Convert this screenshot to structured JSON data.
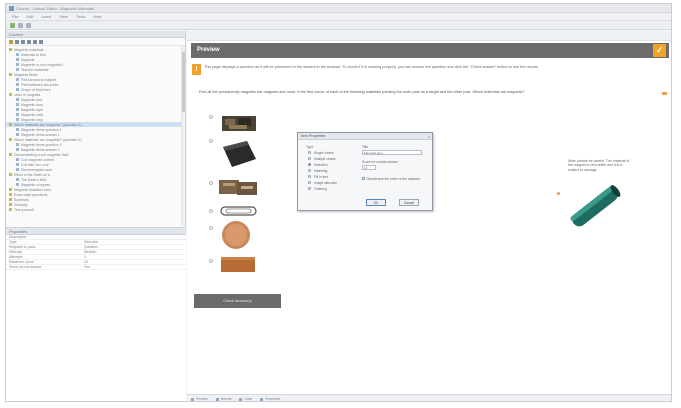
{
  "window": {
    "title": "Course - Lesson Editor - Magnetic Materials"
  },
  "menubar": [
    "File",
    "Edit",
    "Insert",
    "View",
    "Tools",
    "Help"
  ],
  "left_pane": {
    "header": "Content",
    "tree": [
      {
        "label": "Magnetic materials",
        "level": 0,
        "type": "folder"
      },
      {
        "label": "Materials to test",
        "level": 1,
        "type": "page"
      },
      {
        "label": "Magnets",
        "level": 1,
        "type": "page"
      },
      {
        "label": "Magnetic or non-magnetic?",
        "level": 1,
        "type": "page"
      },
      {
        "label": "Test the materials",
        "level": 1,
        "type": "page"
      },
      {
        "label": "Magnetic fields",
        "level": 0,
        "type": "folder"
      },
      {
        "label": "Field around a magnet",
        "level": 1,
        "type": "page"
      },
      {
        "label": "Field between two poles",
        "level": 1,
        "type": "page"
      },
      {
        "label": "Shape of field lines",
        "level": 1,
        "type": "page"
      },
      {
        "label": "Uses of magnets",
        "level": 0,
        "type": "folder"
      },
      {
        "label": "Magnetic lock",
        "level": 1,
        "type": "page"
      },
      {
        "label": "Magnetic door",
        "level": 1,
        "type": "page"
      },
      {
        "label": "Magnetic tape",
        "level": 1,
        "type": "page"
      },
      {
        "label": "Magnetic card",
        "level": 1,
        "type": "page"
      },
      {
        "label": "Magnetic strip",
        "level": 1,
        "type": "page"
      },
      {
        "label": "Which materials are magnetic? (question 1)",
        "level": 0,
        "type": "folder",
        "selected": true
      },
      {
        "label": "Magnetic items question 1",
        "level": 1,
        "type": "page"
      },
      {
        "label": "Magnetic items answer 1",
        "level": 1,
        "type": "page"
      },
      {
        "label": "Which materials are magnetic? (question 2)",
        "level": 0,
        "type": "folder"
      },
      {
        "label": "Magnetic items question 2",
        "level": 1,
        "type": "page"
      },
      {
        "label": "Magnetic items answer 2",
        "level": 1,
        "type": "page"
      },
      {
        "label": "Demonstrating a coil magnetic field",
        "level": 0,
        "type": "folder"
      },
      {
        "label": "Coil magnetic current",
        "level": 1,
        "type": "page"
      },
      {
        "label": "Coil with iron core",
        "level": 1,
        "type": "page"
      },
      {
        "label": "Electromagnet uses",
        "level": 1,
        "type": "page"
      },
      {
        "label": "Effect of the Earth on a",
        "level": 0,
        "type": "folder"
      },
      {
        "label": "The Earth's field",
        "level": 1,
        "type": "page"
      },
      {
        "label": "Magnetic compass",
        "level": 1,
        "type": "page"
      },
      {
        "label": "Magnetic levitation train",
        "level": 0,
        "type": "folder"
      },
      {
        "label": "Exam-style questions",
        "level": 0,
        "type": "folder"
      },
      {
        "label": "Summary",
        "level": 0,
        "type": "folder"
      },
      {
        "label": "Glossary",
        "level": 0,
        "type": "folder"
      },
      {
        "label": "Test yourself",
        "level": 0,
        "type": "folder"
      }
    ],
    "props_header": "Properties",
    "properties": [
      {
        "key": "Description",
        "value": ""
      },
      {
        "key": "Type",
        "value": "Selection"
      },
      {
        "key": "Required to pass",
        "value": "Question"
      },
      {
        "key": "Difficulty",
        "value": "Medium"
      },
      {
        "key": "Attempts",
        "value": "1"
      },
      {
        "key": "Maximum score",
        "value": "10"
      },
      {
        "key": "Show correct answer",
        "value": "Yes"
      }
    ]
  },
  "main": {
    "preview_title": "Preview",
    "instructions": "This page displays a question as it will be presented to the student in the browser. To check if it is working properly, you can answer the question and click the \"Check answer\" button to see the results.",
    "question": "Find all the permanently magnetic bar magnets and more. If the first corner of each of the following materials pointing the north pole as a target and the other pole. Which materials are magnetic?",
    "options": [
      {
        "name": "option-1",
        "label": "Iron filings"
      },
      {
        "name": "option-2",
        "label": "Magnet block"
      },
      {
        "name": "option-3",
        "label": "Steel nails"
      },
      {
        "name": "option-4",
        "label": "Paper clip"
      },
      {
        "name": "option-5",
        "label": "Copper coin"
      },
      {
        "name": "option-6",
        "label": "Wood block"
      }
    ],
    "note": "Note: please be careful. The material of the magnet is very brittle and it is a subject to damage.",
    "check_button": "Check answer(s)"
  },
  "dialog": {
    "title": "Item Properties",
    "close": "×",
    "type_label": "Type",
    "types": [
      "Single choice",
      "Multiple choice",
      "Selection",
      "Matching",
      "Fill in text",
      "Image selection",
      "Ordering"
    ],
    "selected_type": "Selection",
    "title_label": "Title",
    "title_value": "Magnetic item",
    "score_label": "Score for correct answer",
    "score_value": "10",
    "option_label": "Randomize the order of the answers",
    "ok": "OK",
    "cancel": "Cancel"
  },
  "statusbar": [
    "Preview",
    "Normal",
    "Code",
    "Properties"
  ]
}
